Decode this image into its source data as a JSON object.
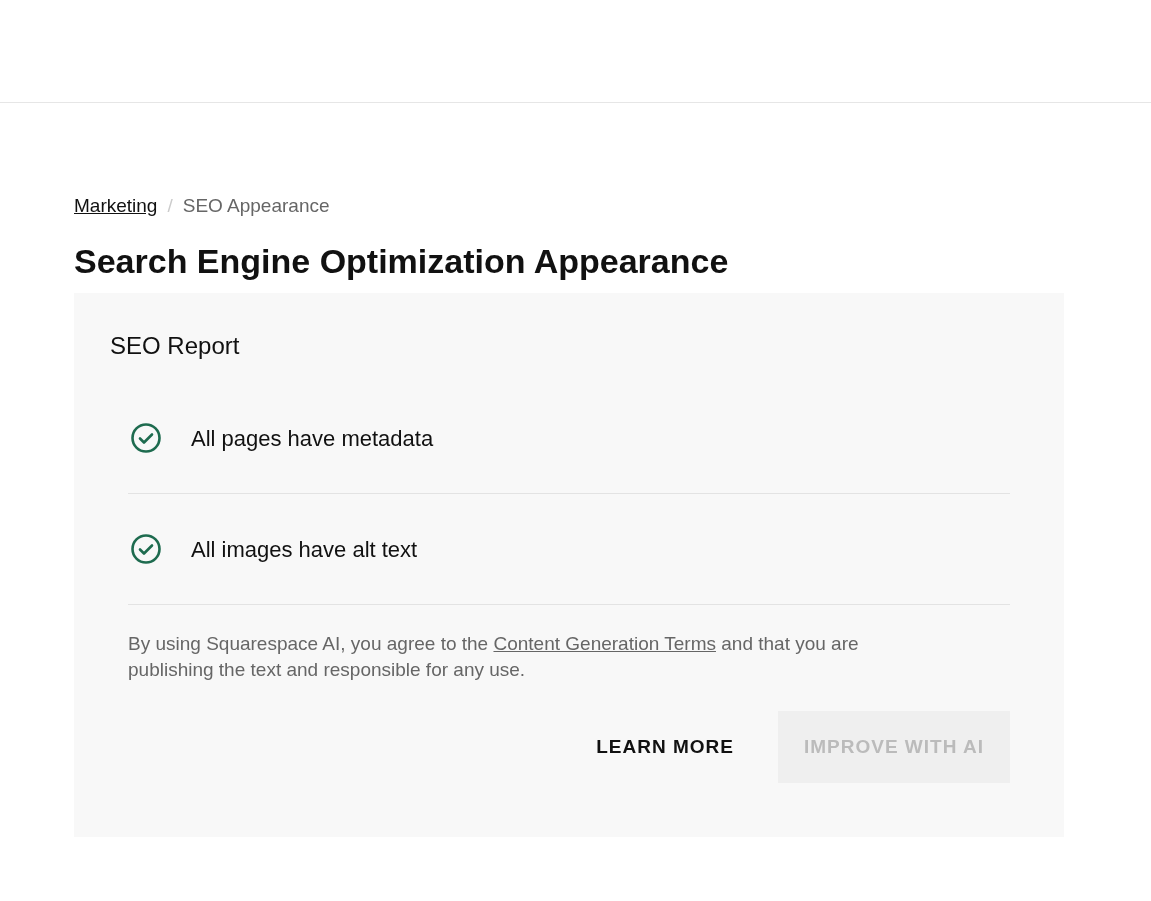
{
  "breadcrumb_separator": "/",
  "breadcrumb": [
    {
      "label": "Marketing",
      "kind": "link"
    },
    {
      "label": "SEO Appearance",
      "kind": "current"
    }
  ],
  "title": "Search Engine Optimization Appearance",
  "report": {
    "title": "SEO Report",
    "checks": [
      {
        "text": "All pages have metadata",
        "passed": true
      },
      {
        "text": "All images have alt text",
        "passed": true
      }
    ],
    "disclaimer": {
      "before": "By using Squarespace AI, you agree to the",
      "link": "Content Generation Terms",
      "after": "and that you are publishing the text and responsible for any use."
    },
    "buttons": [
      {
        "label": "LEARN MORE",
        "disabled": false,
        "kind": "text"
      },
      {
        "label": "IMPROVE WITH AI",
        "disabled": true,
        "kind": "filled"
      }
    ]
  }
}
